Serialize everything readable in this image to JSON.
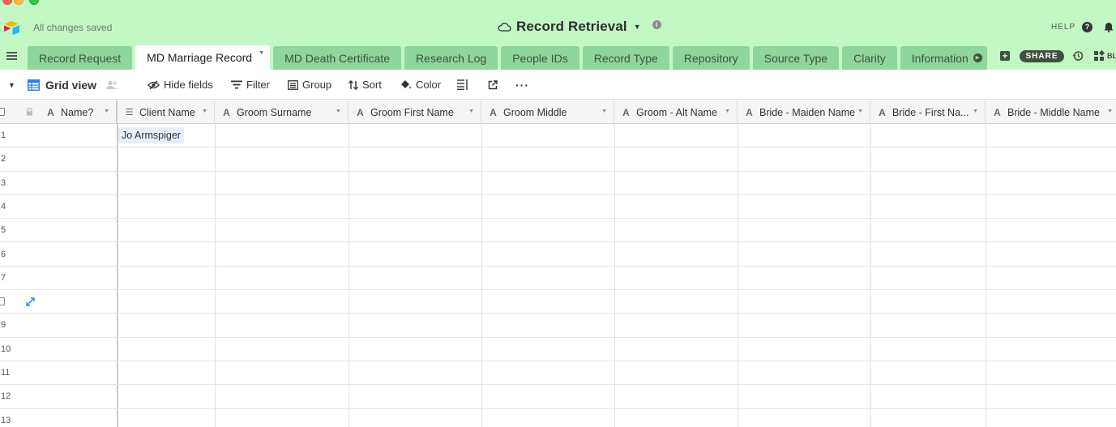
{
  "app": {
    "save_status": "All changes saved",
    "base_name": "Record Retrieval",
    "help_label": "HELP",
    "share_label": "SHARE",
    "blocks_label": "BL"
  },
  "tabs": [
    {
      "label": "Record Request"
    },
    {
      "label": "MD Marriage Record",
      "active": true
    },
    {
      "label": "MD Death Certificate"
    },
    {
      "label": "Research Log"
    },
    {
      "label": "People IDs"
    },
    {
      "label": "Record Type"
    },
    {
      "label": "Repository"
    },
    {
      "label": "Source Type"
    },
    {
      "label": "Clarity"
    },
    {
      "label": "Information"
    }
  ],
  "toolbar": {
    "view_name": "Grid view",
    "hide_fields": "Hide fields",
    "filter": "Filter",
    "group": "Group",
    "sort": "Sort",
    "color": "Color"
  },
  "columns": [
    {
      "label": "Name?",
      "type_icon": "text-field-icon"
    },
    {
      "label": "Client Name",
      "type_icon": "linked-record-icon"
    },
    {
      "label": "Groom Surname",
      "type_icon": "text-field-icon"
    },
    {
      "label": "Groom First Name",
      "type_icon": "text-field-icon"
    },
    {
      "label": "Groom Middle",
      "type_icon": "text-field-icon"
    },
    {
      "label": "Groom - Alt Name",
      "type_icon": "text-field-icon"
    },
    {
      "label": "Bride - Maiden Name",
      "type_icon": "text-field-icon"
    },
    {
      "label": "Bride - First Na...",
      "type_icon": "text-field-icon"
    },
    {
      "label": "Bride - Middle Name",
      "type_icon": "text-field-icon"
    }
  ],
  "rows": [
    {
      "num": "1",
      "client_name": "Jo Armspiger"
    },
    {
      "num": "2"
    },
    {
      "num": "3"
    },
    {
      "num": "4"
    },
    {
      "num": "5"
    },
    {
      "num": "6"
    },
    {
      "num": "7"
    },
    {
      "num": "",
      "hovered": true
    },
    {
      "num": "9"
    },
    {
      "num": "10"
    },
    {
      "num": "11"
    },
    {
      "num": "12"
    },
    {
      "num": "13"
    }
  ],
  "colors": {
    "header_bg": "#c3f8c5",
    "tab_bg": "#8ed69b",
    "tab_text": "#3d5240",
    "accent_blue": "#2d7ff9",
    "chip_bg": "#e6edfb"
  }
}
